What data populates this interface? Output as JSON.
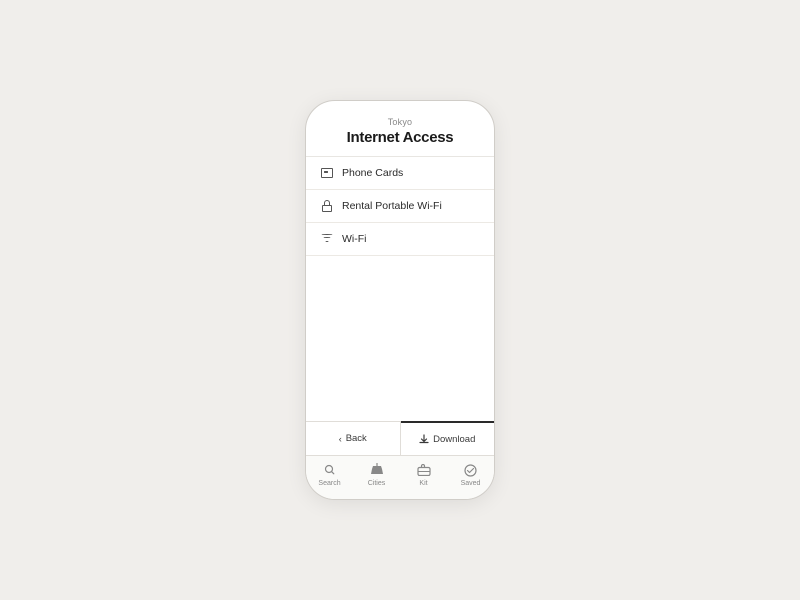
{
  "header": {
    "city": "Tokyo",
    "title": "Internet Access"
  },
  "menu": {
    "items": [
      {
        "id": "phone-cards",
        "label": "Phone Cards",
        "icon": "phone-card-icon"
      },
      {
        "id": "rental-wifi",
        "label": "Rental Portable Wi-Fi",
        "icon": "rental-wifi-icon"
      },
      {
        "id": "wifi",
        "label": "Wi-Fi",
        "icon": "wifi-icon"
      }
    ]
  },
  "bottom_actions": {
    "back_label": "Back",
    "download_label": "Download"
  },
  "tab_bar": {
    "items": [
      {
        "id": "search",
        "label": "Search",
        "icon": "search-icon"
      },
      {
        "id": "cities",
        "label": "Cities",
        "icon": "cities-icon"
      },
      {
        "id": "kit",
        "label": "Kit",
        "icon": "kit-icon"
      },
      {
        "id": "saved",
        "label": "Saved",
        "icon": "saved-icon"
      }
    ]
  }
}
